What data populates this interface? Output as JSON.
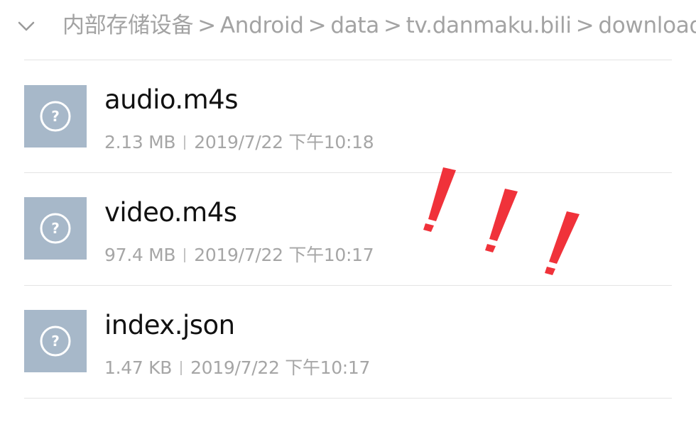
{
  "breadcrumb": {
    "collapse_icon": "chevron-down-icon",
    "items": [
      "内部存储设备",
      "Android",
      "data",
      "tv.danmaku.bili",
      "download"
    ],
    "separator": ">"
  },
  "files": [
    {
      "name": "audio.m4s",
      "size": "2.13 MB",
      "date": "2019/7/22 下午10:18",
      "icon": "unknown-file-icon"
    },
    {
      "name": "video.m4s",
      "size": "97.4 MB",
      "date": "2019/7/22 下午10:17",
      "icon": "unknown-file-icon"
    },
    {
      "name": "index.json",
      "size": "1.47 KB",
      "date": "2019/7/22 下午10:17",
      "icon": "unknown-file-icon"
    }
  ],
  "annotation": {
    "marks": [
      "!",
      "!",
      "!"
    ],
    "color": "#f0323a"
  },
  "colors": {
    "file_icon_bg": "#a7b8c9",
    "secondary_text": "#a6a6a6",
    "divider": "#e4e4e4"
  }
}
